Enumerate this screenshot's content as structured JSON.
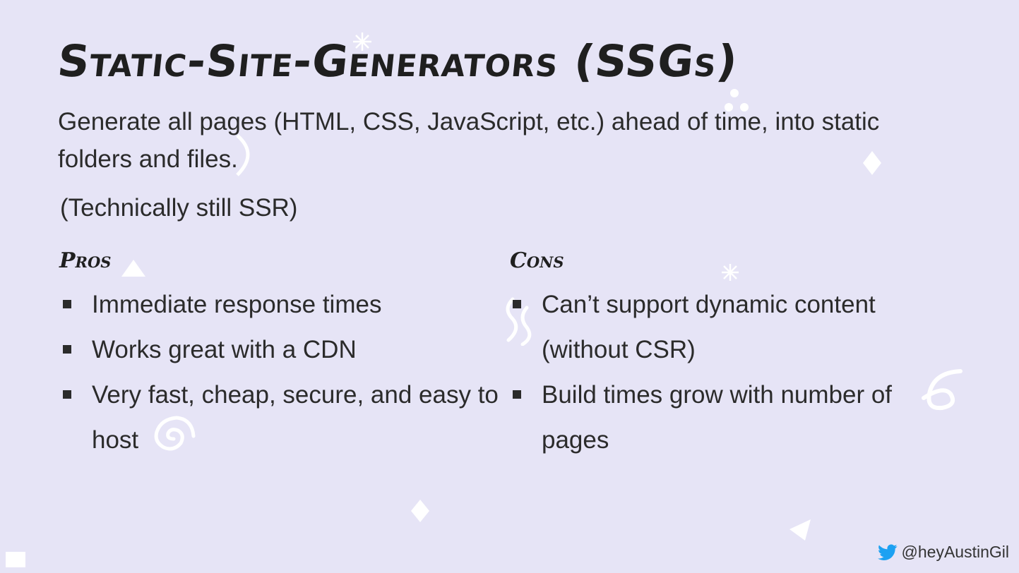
{
  "slide": {
    "title": "Static-Site-Generators (SSGs)",
    "intro": "Generate all pages (HTML, CSS, JavaScript, etc.) ahead of time, into static folders and files.",
    "note": "(Technically still SSR)"
  },
  "pros": {
    "heading": "Pros",
    "items": [
      "Immediate response times",
      "Works great with a CDN",
      "Very fast, cheap, secure, and easy to host"
    ]
  },
  "cons": {
    "heading": "Cons",
    "items": [
      "Can’t support dynamic content (without CSR)",
      "Build times grow with number of pages"
    ]
  },
  "footer": {
    "handle": "@heyAustinGil",
    "icon": "twitter-bird-icon",
    "icon_color": "#1da1f2"
  },
  "colors": {
    "background": "#e6e4f6",
    "text": "#2b2b2b",
    "decoration": "#ffffff"
  }
}
